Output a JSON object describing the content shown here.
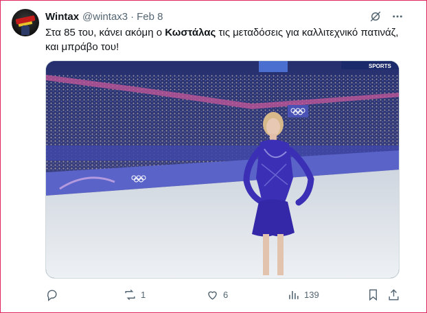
{
  "tweet": {
    "author_name": "Wintax",
    "handle": "@wintax3",
    "separator": "·",
    "date": "Feb 8",
    "text_before": "Στα 85 του, κάνει ακόμη ο ",
    "text_bold": "Κωστάλας",
    "text_after": " τις μεταδόσεις για καλλιτεχνικό πατινάζ, και μπράβο του!"
  },
  "media": {
    "signs": {
      "sports": "SPORTS"
    },
    "colors": {
      "ice": "#dfe6ec",
      "boards": "#5a63c8",
      "dress": "#3b2fb5"
    }
  },
  "actions": {
    "reply": "",
    "retweet": "1",
    "likes": "6",
    "views": "139"
  },
  "icons": {
    "grok": "grok-icon",
    "more": "more-icon",
    "reply": "reply-icon",
    "retweet": "retweet-icon",
    "like": "heart-icon",
    "views": "analytics-icon",
    "bookmark": "bookmark-icon",
    "share": "share-icon"
  }
}
